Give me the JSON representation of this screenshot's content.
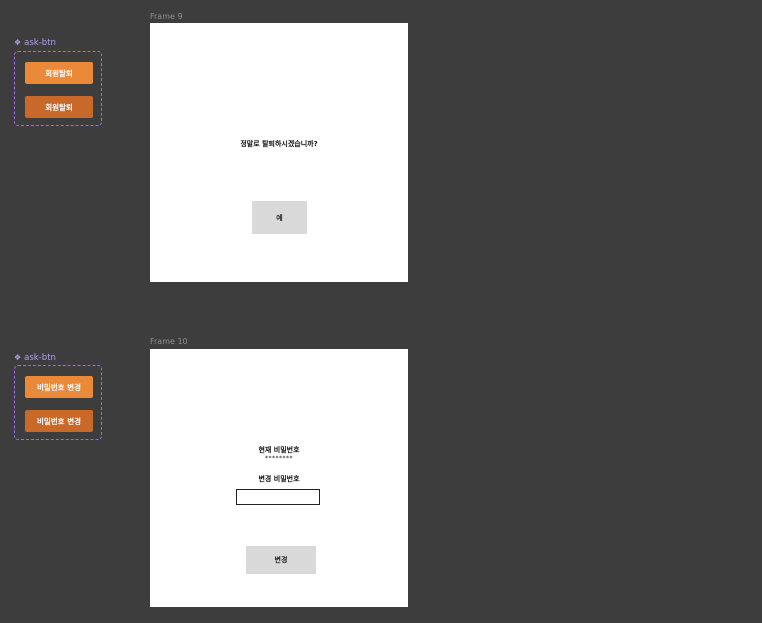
{
  "component_sets": [
    {
      "label": "ask-btn",
      "variants": [
        "회원탈퇴",
        "회원탈퇴"
      ]
    },
    {
      "label": "ask-btn",
      "variants": [
        "비밀번호 변경",
        "비밀번호 변경"
      ]
    }
  ],
  "frame9": {
    "label": "Frame 9",
    "question": "정말로 탈퇴하시겠습니까?",
    "confirm_label": "예"
  },
  "frame10": {
    "label": "Frame 10",
    "current_password_label": "현재 비밀번호",
    "current_password_value": "********",
    "new_password_label": "변경 비밀번호",
    "new_password_value": "",
    "submit_label": "변경"
  },
  "colors": {
    "canvas": "#3d3d3d",
    "component_accent": "#9b6bf0",
    "button_default": "#ea8a38",
    "button_hover": "#c8692a",
    "frame_button": "#d9d9d9"
  },
  "icons": {
    "component": "component-diamond-icon"
  }
}
